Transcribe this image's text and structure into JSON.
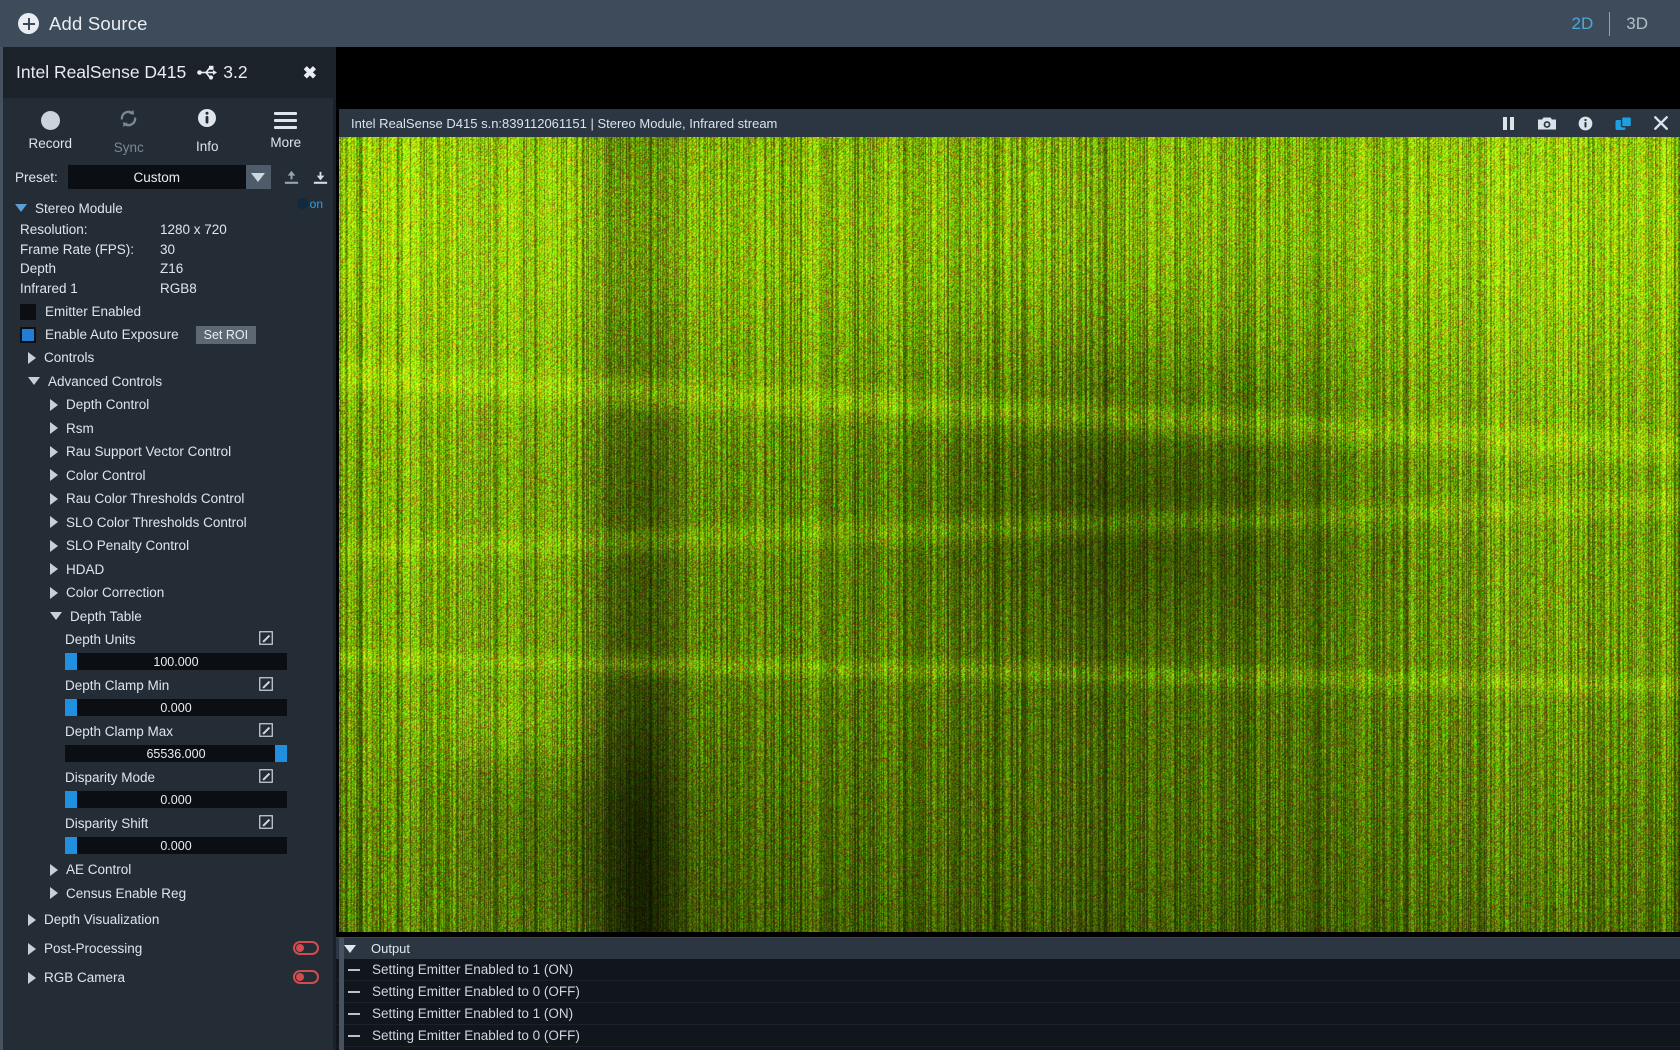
{
  "topbar": {
    "add_source_label": "Add Source",
    "add_source_icon": "plus-circle-icon",
    "view_2d": "2D",
    "view_3d": "3D",
    "active_view": "2D",
    "accent_color": "#4ba8d8"
  },
  "device": {
    "name": "Intel RealSense D415",
    "usb_icon": "usb-icon",
    "usb_version": "3.2",
    "close_icon": "close-icon"
  },
  "toolbar": {
    "record_label": "Record",
    "sync_label": "Sync",
    "info_label": "Info",
    "more_label": "More",
    "record_icon": "record-dot-icon",
    "sync_icon": "sync-refresh-icon",
    "info_icon": "info-circle-icon",
    "more_icon": "hamburger-icon"
  },
  "preset": {
    "label": "Preset:",
    "value": "Custom",
    "caret_icon": "chevron-down-icon",
    "upload_icon": "upload-icon",
    "download_icon": "download-icon"
  },
  "stereo_module": {
    "title": "Stereo Module",
    "enabled": true,
    "toggle_label": "on",
    "info": [
      {
        "key": "Resolution:",
        "value": "1280 x 720"
      },
      {
        "key": "Frame Rate (FPS):",
        "value": "30"
      },
      {
        "key": "Depth",
        "value": "Z16"
      },
      {
        "key": "Infrared 1",
        "value": "RGB8"
      }
    ],
    "checkboxes": [
      {
        "label": "Emitter Enabled",
        "checked": false
      },
      {
        "label": "Enable Auto Exposure",
        "checked": true,
        "button": "Set ROI"
      }
    ]
  },
  "tree": {
    "controls": "Controls",
    "advanced_controls": "Advanced Controls",
    "advanced_children": [
      "Depth Control",
      "Rsm",
      "Rau Support Vector Control",
      "Color Control",
      "Rau Color Thresholds Control",
      "SLO Color Thresholds Control",
      "SLO Penalty Control",
      "HDAD",
      "Color Correction"
    ],
    "depth_table": "Depth Table",
    "after_depth_table": [
      "AE Control",
      "Census Enable Reg"
    ],
    "depth_visualization": "Depth Visualization",
    "post_processing": "Post-Processing",
    "rgb_camera": "RGB Camera"
  },
  "depth_table_sliders": [
    {
      "label": "Depth Units",
      "value": "100.000",
      "handle_pct": 0,
      "edit_icon": "edit-icon"
    },
    {
      "label": "Depth Clamp Min",
      "value": "0.000",
      "handle_pct": 0,
      "edit_icon": "edit-icon"
    },
    {
      "label": "Depth Clamp Max",
      "value": "65536.000",
      "handle_pct": 100,
      "edit_icon": "edit-icon"
    },
    {
      "label": "Disparity Mode",
      "value": "0.000",
      "handle_pct": 0,
      "edit_icon": "edit-icon"
    },
    {
      "label": "Disparity Shift",
      "value": "0.000",
      "handle_pct": 0,
      "edit_icon": "edit-icon"
    }
  ],
  "stream": {
    "title": "Intel RealSense D415 s.n:839112061151 | Stereo Module, Infrared stream",
    "icons": [
      {
        "name": "pause-icon",
        "active": false
      },
      {
        "name": "snapshot-icon",
        "active": false
      },
      {
        "name": "info-icon",
        "active": false
      },
      {
        "name": "expand-icon",
        "active": true
      },
      {
        "name": "close-icon",
        "active": false
      }
    ],
    "expand_icon_color": "#1f9fe0"
  },
  "output": {
    "title": "Output",
    "collapse_icon": "triangle-down-icon",
    "rows": [
      "Setting Emitter Enabled to 1 (ON)",
      "Setting Emitter Enabled to 0 (OFF)",
      "Setting Emitter Enabled to 1 (ON)",
      "Setting Emitter Enabled to 0 (OFF)"
    ]
  }
}
